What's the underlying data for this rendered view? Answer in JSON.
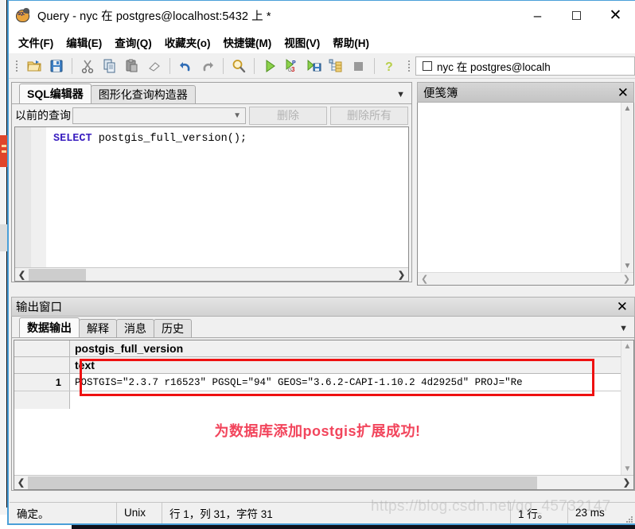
{
  "window": {
    "title": "Query - nyc 在  postgres@localhost:5432 上 *",
    "app_icon": "postgresql-elephant-icon",
    "minimize_label": "–",
    "maximize_label": "☐",
    "close_label": "✕"
  },
  "menubar": {
    "items": [
      {
        "label": "文件(F)",
        "name": "menu-file"
      },
      {
        "label": "编辑(E)",
        "name": "menu-edit"
      },
      {
        "label": "查询(Q)",
        "name": "menu-query"
      },
      {
        "label": "收藏夹(o)",
        "name": "menu-favourites"
      },
      {
        "label": "快捷键(M)",
        "name": "menu-macros"
      },
      {
        "label": "视图(V)",
        "name": "menu-view"
      },
      {
        "label": "帮助(H)",
        "name": "menu-help"
      }
    ]
  },
  "toolbar": {
    "buttons": [
      {
        "icon": "open-folder-icon",
        "name": "open-file-button"
      },
      {
        "icon": "save-floppy-icon",
        "name": "save-file-button"
      },
      {
        "icon": "scissors-icon",
        "name": "cut-button"
      },
      {
        "icon": "copy-icon",
        "name": "copy-button"
      },
      {
        "icon": "paste-icon",
        "name": "paste-button"
      },
      {
        "icon": "eraser-icon",
        "name": "clear-button"
      },
      {
        "icon": "undo-arrow-icon",
        "name": "undo-button"
      },
      {
        "icon": "redo-arrow-icon",
        "name": "redo-button"
      },
      {
        "icon": "magnifier-icon",
        "name": "find-replace-button"
      },
      {
        "icon": "green-play-icon",
        "name": "execute-query-button"
      },
      {
        "icon": "play-pgscript-icon",
        "name": "execute-pgscript-button"
      },
      {
        "icon": "play-save-file-icon",
        "name": "execute-to-file-button"
      },
      {
        "icon": "explain-tree-icon",
        "name": "explain-query-button"
      },
      {
        "icon": "stop-square-icon",
        "name": "cancel-query-button"
      },
      {
        "icon": "question-help-icon",
        "name": "help-button"
      }
    ],
    "database_combo": {
      "checkbox": "unchecked",
      "label": "nyc 在  postgres@localh"
    }
  },
  "editor_panel": {
    "tabs": [
      {
        "label": "SQL编辑器",
        "active": true,
        "name": "tab-sql-editor"
      },
      {
        "label": "图形化查询构造器",
        "active": false,
        "name": "tab-graphical-query-builder"
      }
    ],
    "tab_overflow_icon": "chevron-down-icon",
    "previous_query": {
      "label": "以前的查询",
      "value": "",
      "placeholder": "",
      "dropdown_icon": "chevron-down-icon",
      "delete_label": "删除",
      "delete_all_label": "删除所有"
    },
    "sql": {
      "keyword": "SELECT",
      "rest": " postgis_full_version();",
      "full_text": "SELECT postgis_full_version();"
    },
    "hscroll": {
      "left_icon": "chevron-left-icon",
      "right_icon": "chevron-right-icon"
    }
  },
  "scratchpad": {
    "title": "便笺簿",
    "close_icon": "close-icon",
    "content": "",
    "scroll_up_icon": "chevron-up-icon",
    "scroll_down_icon": "chevron-down-icon",
    "scroll_left_icon": "chevron-left-icon",
    "scroll_right_icon": "chevron-right-icon"
  },
  "output_window": {
    "title": "输出窗口",
    "close_icon": "close-icon",
    "tabs": [
      {
        "label": "数据输出",
        "active": true,
        "name": "tab-data-output"
      },
      {
        "label": "解释",
        "active": false,
        "name": "tab-explain"
      },
      {
        "label": "消息",
        "active": false,
        "name": "tab-messages"
      },
      {
        "label": "历史",
        "active": false,
        "name": "tab-history"
      }
    ],
    "tab_overflow_icon": "chevron-down-icon",
    "grid": {
      "column_header": "postgis_full_version",
      "column_type": "text",
      "rows": [
        {
          "number": "1",
          "value": "POSTGIS=\"2.3.7 r16523\" PGSQL=\"94\" GEOS=\"3.6.2-CAPI-1.10.2 4d2925d\" PROJ=\"Re"
        }
      ]
    },
    "annotation": {
      "text": "为数据库添加postgis扩展成功!",
      "color": "#f2455c",
      "box_color": "#ee1111"
    }
  },
  "statusbar": {
    "status": "确定。",
    "line_ending": "Unix",
    "position": "行 1，列 31，字符 31",
    "row_count": "1 行。",
    "duration": "23 ms"
  },
  "watermark": {
    "text": "https://blog.csdn.net/qq_45732147"
  },
  "colors": {
    "window_border": "#4a9fd8",
    "chrome": "#f0f0f0",
    "accent_red": "#ee1111",
    "note_red": "#f2455c",
    "sql_keyword": "#3a1fc0"
  }
}
